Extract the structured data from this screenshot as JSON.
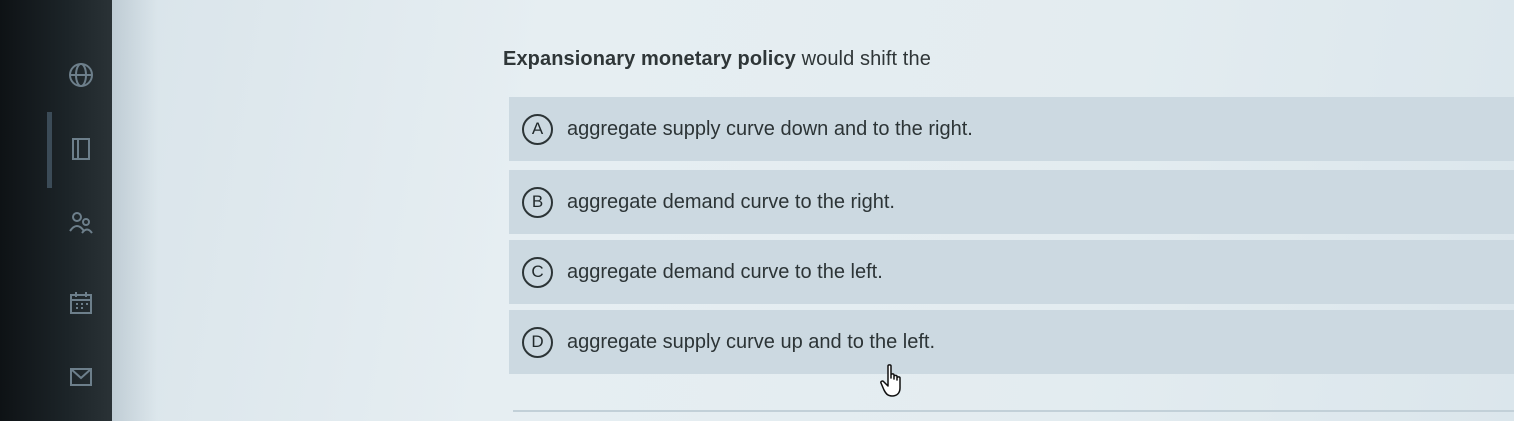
{
  "question": {
    "bold_text": "Expansionary monetary policy",
    "rest_text": " would shift the"
  },
  "options": [
    {
      "letter": "A",
      "text": "aggregate supply curve down and to the right."
    },
    {
      "letter": "B",
      "text": "aggregate demand curve to the right."
    },
    {
      "letter": "C",
      "text": "aggregate demand curve to the left."
    },
    {
      "letter": "D",
      "text": "aggregate supply curve up and to the left."
    }
  ],
  "sidebar": {
    "icons": [
      "globe-icon",
      "book-icon",
      "people-icon",
      "calendar-icon",
      "mail-icon"
    ]
  },
  "colors": {
    "option_background": "#ccd9e1",
    "content_background": "#e3ecf0",
    "text": "#2c3436"
  }
}
